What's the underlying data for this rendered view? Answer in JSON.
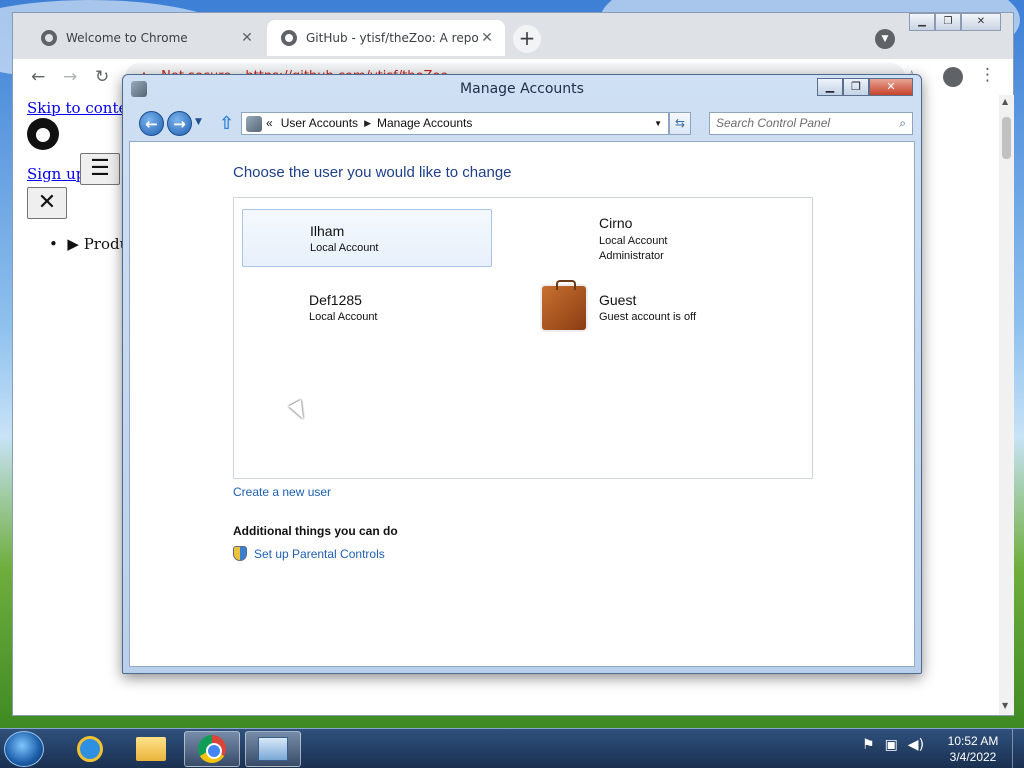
{
  "chrome": {
    "tabs": [
      {
        "label": "Welcome to Chrome",
        "close": "✕"
      },
      {
        "label": "GitHub - ytisf/theZoo: A reposito",
        "close": "✕"
      }
    ],
    "new_tab": "+",
    "omnibox": {
      "warning_icon": "warning-icon",
      "security_label": "Not secure",
      "url": "https://github.com/ytisf/theZoo"
    }
  },
  "page": {
    "skip_link": "Skip to content",
    "sign_up": "Sign up",
    "menu_glyph": "☰",
    "close_glyph": "✕",
    "products": "▶ Produ"
  },
  "window": {
    "title": "Manage Accounts",
    "breadcrumb": {
      "lead": "«",
      "items": [
        "User Accounts",
        "Manage Accounts"
      ]
    },
    "search_placeholder": "Search Control Panel",
    "heading": "Choose the user you would like to change",
    "users": [
      {
        "name": "Ilham",
        "line1": "Local Account",
        "line2": ""
      },
      {
        "name": "Cirno",
        "line1": "Local Account",
        "line2": "Administrator"
      },
      {
        "name": "Def1285",
        "line1": "Local Account",
        "line2": ""
      },
      {
        "name": "Guest",
        "line1": "Guest account is off",
        "line2": ""
      }
    ],
    "create_user": "Create a new user",
    "additional_heading": "Additional things you can do",
    "parental_controls": "Set up Parental Controls"
  },
  "taskbar": {
    "time": "10:52 AM",
    "date": "3/4/2022"
  }
}
